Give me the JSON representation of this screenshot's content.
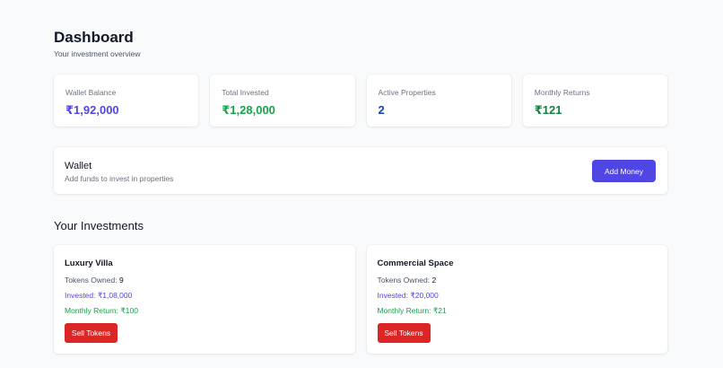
{
  "header": {
    "title": "Dashboard",
    "subtitle": "Your investment overview"
  },
  "stats": [
    {
      "label": "Wallet Balance",
      "value": "₹1,92,000",
      "color": "#4f46e5"
    },
    {
      "label": "Total Invested",
      "value": "₹1,28,000",
      "color": "#16a34a"
    },
    {
      "label": "Active Properties",
      "value": "2",
      "color": "#1e40af"
    },
    {
      "label": "Monthly Returns",
      "value": "₹121",
      "color": "#15803d"
    }
  ],
  "wallet": {
    "title": "Wallet",
    "subtitle": "Add funds to invest in properties",
    "button_label": "Add Money"
  },
  "investments": {
    "title": "Your Investments",
    "items": [
      {
        "name": "Luxury Villa",
        "tokens_label": "Tokens Owned: ",
        "tokens": "9",
        "invested": "Invested: ₹1,08,000",
        "monthly_return": "Monthly Return: ₹100",
        "button_label": "Sell Tokens"
      },
      {
        "name": "Commercial Space",
        "tokens_label": "Tokens Owned: ",
        "tokens": "2",
        "invested": "Invested: ₹20,000",
        "monthly_return": "Monthly Return: ₹21",
        "button_label": "Sell Tokens"
      }
    ]
  },
  "colors": {
    "primary": "#4f46e5",
    "success": "#16a34a",
    "danger": "#dc2626",
    "background": "#f9fafb"
  }
}
